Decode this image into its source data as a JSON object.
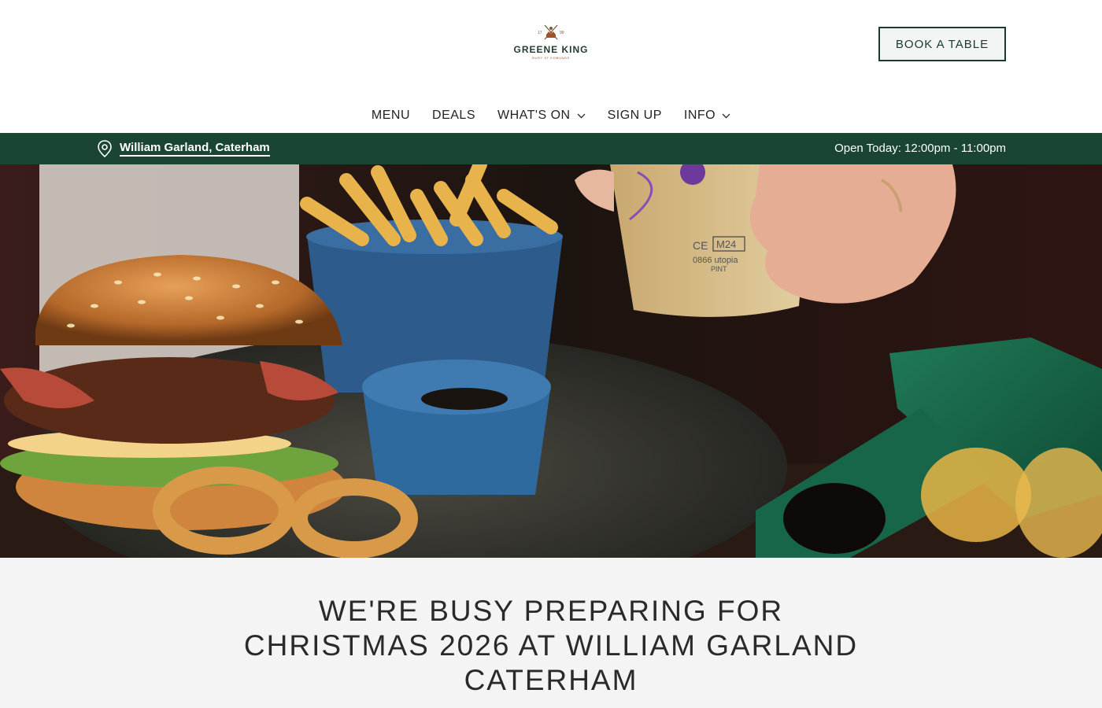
{
  "header": {
    "logo": {
      "name": "GREENE KING",
      "sub": "BURY ST EDMUNDS",
      "year_left": "17",
      "year_right": "99"
    },
    "book_button": "BOOK A TABLE"
  },
  "nav": {
    "items": [
      {
        "label": "MENU",
        "dropdown": false
      },
      {
        "label": "DEALS",
        "dropdown": false
      },
      {
        "label": "WHAT'S ON",
        "dropdown": true
      },
      {
        "label": "SIGN UP",
        "dropdown": false
      },
      {
        "label": "INFO",
        "dropdown": true
      }
    ]
  },
  "location_bar": {
    "location": "William Garland, Caterham",
    "hours": "Open Today: 12:00pm - 11:00pm"
  },
  "hero": {
    "glass_text_1": "M24",
    "glass_text_2": "0866 utopia",
    "glass_text_3": "PINT",
    "glass_mark": "CE"
  },
  "main": {
    "heading_line_1": "WE'RE BUSY PREPARING FOR",
    "heading_line_2": "CHRISTMAS 2026 AT WILLIAM GARLAND",
    "heading_line_3": "CATERHAM"
  },
  "colors": {
    "brand_green": "#1a4532",
    "button_border": "#1a3a2d"
  }
}
